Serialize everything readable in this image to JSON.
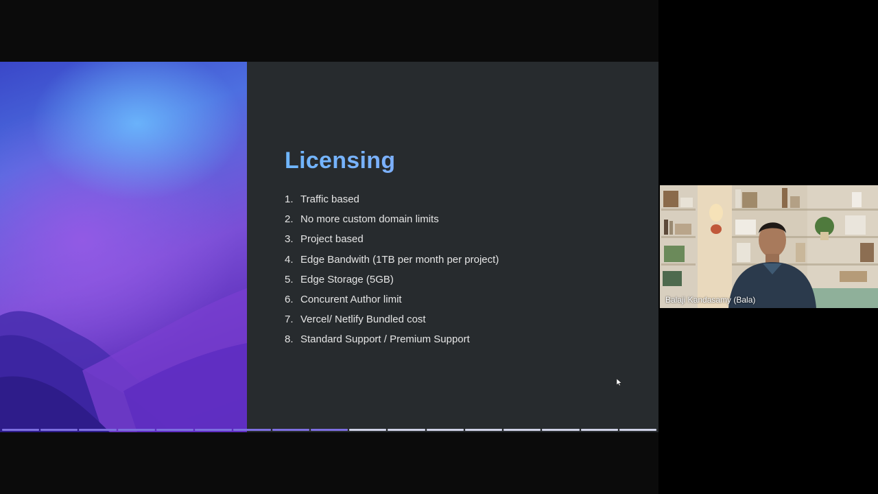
{
  "slide": {
    "title": "Licensing",
    "items": [
      {
        "num": "1.",
        "text": "Traffic based"
      },
      {
        "num": "2.",
        "text": "No more custom domain limits"
      },
      {
        "num": "3.",
        "text": "Project based"
      },
      {
        "num": "4.",
        "text": "Edge Bandwith (1TB per month per project)"
      },
      {
        "num": "5.",
        "text": "Edge Storage (5GB)"
      },
      {
        "num": "6.",
        "text": "Concurent Author limit"
      },
      {
        "num": "7.",
        "text": "Vercel/ Netlify Bundled cost"
      },
      {
        "num": "8.",
        "text": "Standard Support / Premium Support"
      }
    ]
  },
  "progress": {
    "total_segments": 17,
    "completed_segments": 9
  },
  "participant": {
    "name": "Balaji Kandasamy (Bala)"
  },
  "colors": {
    "title_gradient_start": "#6fb6ff",
    "title_gradient_end": "#9aa3f2",
    "slide_background": "#272b2e",
    "progress_done": "#7d6fe0",
    "progress_remaining": "#cfd2e6"
  }
}
